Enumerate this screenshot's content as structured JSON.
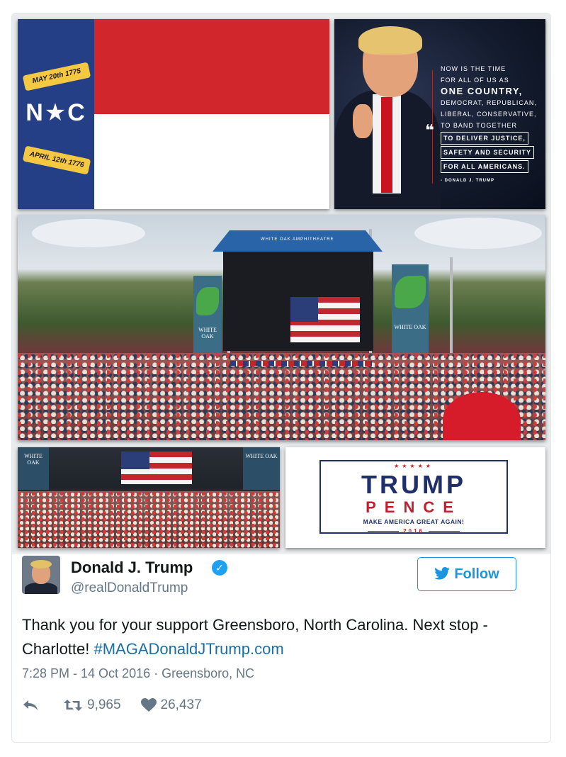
{
  "tweet": {
    "author_name": "Donald J. Trump",
    "handle": "@realDonaldTrump",
    "verified_glyph": "✓",
    "follow_label": "Follow",
    "text_plain": "Thank you for your support Greensboro, North Carolina. Next stop - Charlotte! ",
    "text_link": "#MAGADonaldJTrump.com",
    "time": "7:28 PM - 14 Oct 2016",
    "separator": " · ",
    "location": "Greensboro, NC",
    "retweets": "9,965",
    "likes": "26,437"
  },
  "images": {
    "flag": {
      "scroll_top": "MAY 20th 1775",
      "letters": "N★C",
      "scroll_bottom": "APRIL 12th 1776"
    },
    "quote": {
      "line1": "NOW IS THE TIME",
      "line2": "FOR ALL OF US AS",
      "line3": "ONE COUNTRY,",
      "line4": "DEMOCRAT, REPUBLICAN,",
      "line5": "LIBERAL, CONSERVATIVE,",
      "line6": "TO BAND TOGETHER",
      "line7": "TO DELIVER JUSTICE,",
      "line8": "SAFETY AND SECURITY",
      "line9": "FOR ALL AMERICANS.",
      "signature": "- DONALD J. TRUMP",
      "quote_glyph": "❝"
    },
    "rally": {
      "stage_sign": "WHITE OAK AMPHITHEATRE",
      "banner_left": "WHITE OAK",
      "banner_right": "WHITE OAK"
    },
    "rally2": {
      "banner_left": "WHITE OAK",
      "banner_right": "WHITE OAK"
    },
    "logo": {
      "stars": "★★★★★",
      "top": "TRUMP",
      "middle": "PENCE",
      "slogan": "MAKE AMERICA GREAT AGAIN!",
      "year": "2016"
    }
  },
  "colors": {
    "link": "#1b6fa8",
    "follow": "#1b95e0",
    "muted": "#657786",
    "verified": "#1da1f2"
  }
}
